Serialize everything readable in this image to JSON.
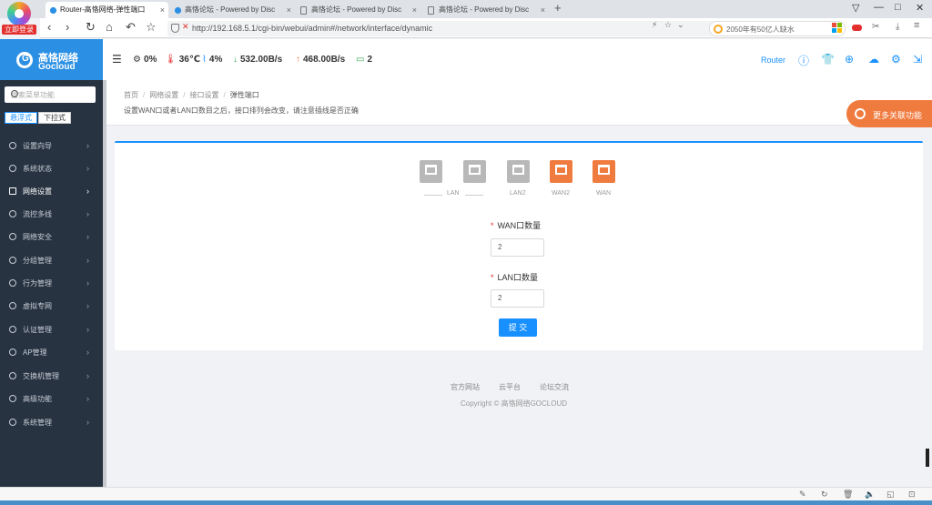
{
  "browser": {
    "login_badge": "立即登录",
    "tabs": [
      {
        "title": "Router-高恪网络-弹性端口",
        "close": "×"
      },
      {
        "title": "高恪论坛 - Powered by Disc",
        "close": "×"
      },
      {
        "title": "高恪论坛 - Powered by Disc",
        "close": "×"
      },
      {
        "title": "高恪论坛 - Powered by Disc",
        "close": "×"
      }
    ],
    "new_tab": "+",
    "url": "http://192.168.5.1/cgi-bin/webui/admin#/network/interface/dynamic",
    "search_placeholder": "2050年有50亿人缺水",
    "window_controls": [
      "▽",
      "—",
      "□",
      "✕"
    ],
    "nav": {
      "back": "‹",
      "forward": "›",
      "reload": "↻",
      "home": "⌂",
      "undo": "↶",
      "star": "☆"
    }
  },
  "header": {
    "brand_cn": "高恪网络",
    "brand_en": "Gocloud",
    "stats": {
      "cpu": "0%",
      "temp": "36℃",
      "mem": "4%",
      "download": "532.00B/s",
      "upload": "468.00B/s",
      "devices": "2"
    },
    "router_label": "Router"
  },
  "sidebar": {
    "search_placeholder": "搜索菜单功能",
    "mode_float": "悬浮式",
    "mode_dropdown": "下拉式",
    "items": [
      {
        "label": "设置向导"
      },
      {
        "label": "系统状态"
      },
      {
        "label": "网络设置"
      },
      {
        "label": "流控多线"
      },
      {
        "label": "网络安全"
      },
      {
        "label": "分组管理"
      },
      {
        "label": "行为管理"
      },
      {
        "label": "虚拟专网"
      },
      {
        "label": "认证管理"
      },
      {
        "label": "AP管理"
      },
      {
        "label": "交换机管理"
      },
      {
        "label": "高级功能"
      },
      {
        "label": "系统管理"
      }
    ],
    "arrow": "›"
  },
  "breadcrumb": {
    "items": [
      "首页",
      "网络设置",
      "接口设置",
      "弹性端口"
    ],
    "separator": "/",
    "note": "设置WAN口或者LAN口数目之后，接口排列会改变，请注意插线是否正确"
  },
  "more_button": "更多关联功能",
  "ports": {
    "labels": {
      "lan": "LAN",
      "lan2": "LAN2",
      "wan2": "WAN2",
      "wan": "WAN"
    }
  },
  "form": {
    "required_mark": "*",
    "wan_label": "WAN口数量",
    "wan_value": "2",
    "lan_label": "LAN口数量",
    "lan_value": "2",
    "submit": "提 交"
  },
  "footer": {
    "links": [
      "官方网站",
      "云平台",
      "论坛交流"
    ],
    "copyright": "Copyright © 高恪网络GOCLOUD"
  },
  "colors": {
    "brand_blue": "#2b8fe3",
    "primary": "#1890ff",
    "port_active": "#f07b3f",
    "port_inactive": "#b8b8b8",
    "sidebar_bg": "#283341"
  }
}
